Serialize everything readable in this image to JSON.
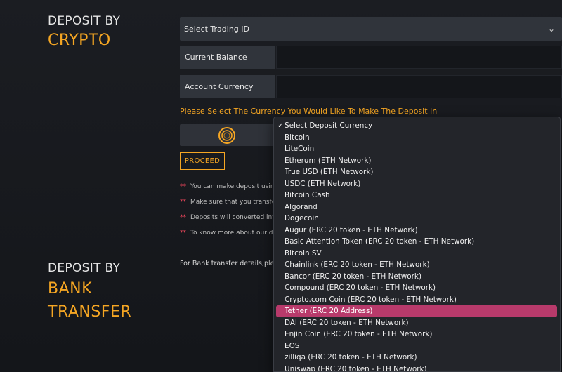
{
  "crypto_section": {
    "title_line1": "DEPOSIT BY",
    "title_line2": "CRYPTO"
  },
  "trading_id_select": {
    "label": "Select Trading ID",
    "chevron": "⌄"
  },
  "fields": {
    "current_balance": "Current Balance",
    "account_currency": "Account Currency"
  },
  "currency_prompt": "Please Select The Currency You Would Like To Make The Deposit In",
  "coin_icon": "coin-icon",
  "proceed_label": "PROCEED",
  "notes": {
    "marker": "**",
    "items": [
      "You can make deposit using any",
      "Make sure that you transfer fund",
      "Deposits will converted into the",
      "To know more about our deposi"
    ]
  },
  "bank_section": {
    "title_line1": "DEPOSIT BY",
    "title_line2": "BANK",
    "title_line3": "TRANSFER"
  },
  "bank_transfer_text": "For Bank transfer details,please c",
  "deposit_currency_dropdown": {
    "check_mark": "✓",
    "selected": "Select Deposit Currency",
    "highlighted": "Tether (ERC 20 Address)",
    "options": [
      "Select Deposit Currency",
      "Bitcoin",
      "LiteCoin",
      "Etherum (ETH Network)",
      "True USD (ETH Network)",
      "USDC (ETH Network)",
      "Bitcoin Cash",
      "Algorand",
      "Dogecoin",
      "Augur (ERC 20 token - ETH Network)",
      "Basic Attention Token (ERC 20 token - ETH Network)",
      "Bitcoin SV",
      "Chainlink (ERC 20 token - ETH Network)",
      "Bancor (ERC 20 token - ETH Network)",
      "Compound (ERC 20 token - ETH Network)",
      "Crypto.com Coin (ERC 20 token - ETH Network)",
      "Tether (ERC 20 Address)",
      "DAI (ERC 20 token - ETH Network)",
      "Enjin Coin (ERC 20 token - ETH Network)",
      "EOS",
      "zilliqa (ERC 20 token - ETH Network)",
      "Uniswap (ERC 20 token - ETH Network)"
    ]
  },
  "colors": {
    "accent": "#f5a623",
    "highlight": "#b83a6b",
    "note_marker": "#e8455a"
  }
}
